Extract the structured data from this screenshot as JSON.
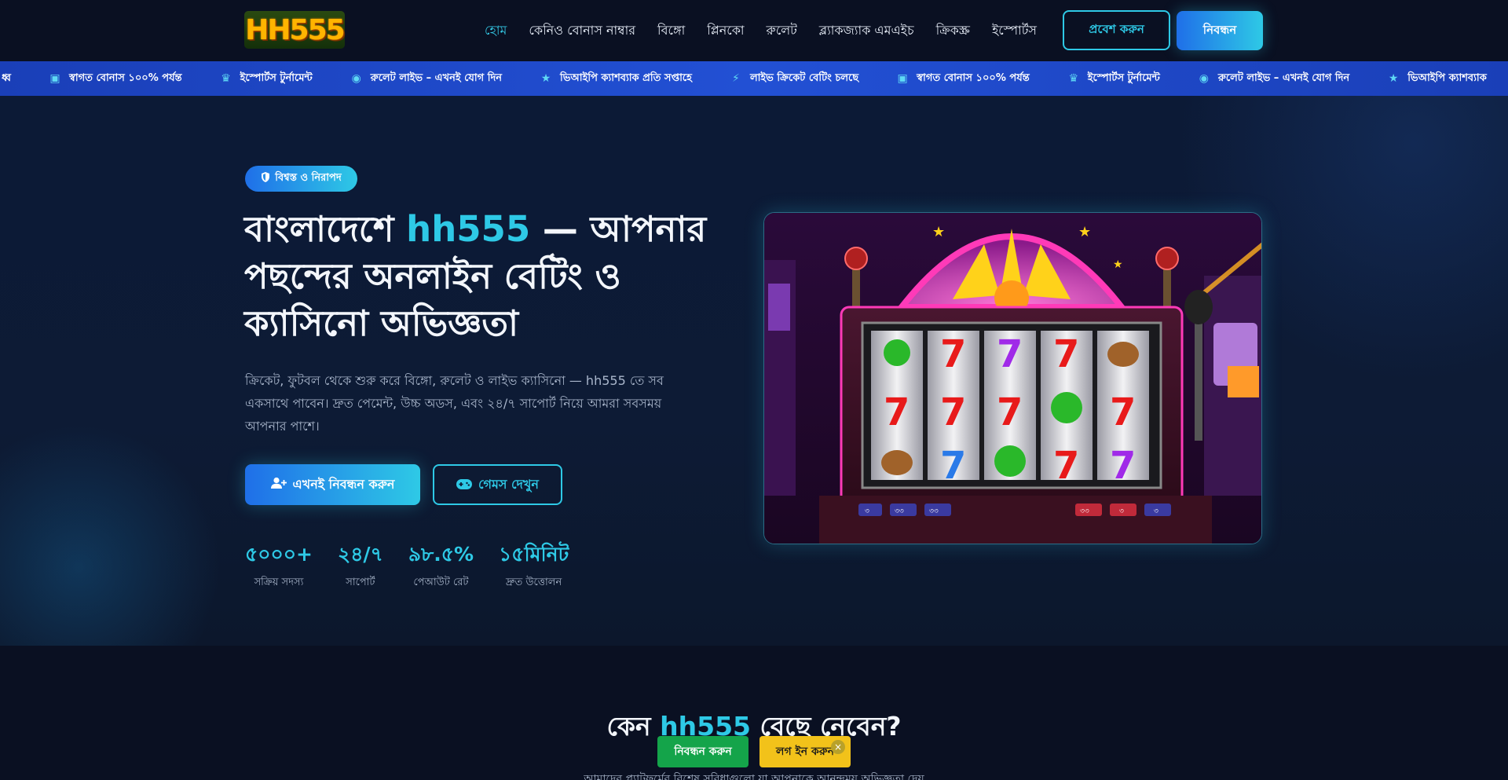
{
  "header": {
    "logo_text": "HH555",
    "nav": [
      {
        "label": "হোম",
        "active": true
      },
      {
        "label": "কেনিও বোনাস নাম্বার"
      },
      {
        "label": "বিঙ্গো"
      },
      {
        "label": "প্লিনকো"
      },
      {
        "label": "রুলেট"
      },
      {
        "label": "ব্ল্যাকজ্যাক এমএইচ"
      },
      {
        "label": "ক্রিকস্ক্র"
      },
      {
        "label": "ইস্পোর্টস"
      }
    ],
    "login_label": "প্রবেশ করুন",
    "register_label": "নিবন্ধন"
  },
  "ticker": {
    "items": [
      {
        "icon": "bolt-icon",
        "text": "ধ্ব"
      },
      {
        "icon": "gift-icon",
        "text": "স্বাগত বোনাস ১০০% পর্যন্ত"
      },
      {
        "icon": "trophy-icon",
        "text": "ইস্পোর্টস টুর্নামেন্ট"
      },
      {
        "icon": "fire-icon",
        "text": "রুলেট লাইভ – এখনই যোগ দিন"
      },
      {
        "icon": "star-icon",
        "text": "ভিআইপি ক্যাশব্যাক প্রতি সপ্তাহে"
      },
      {
        "icon": "bolt-icon",
        "text": "লাইভ ক্রিকেট বেটিং চলছে"
      },
      {
        "icon": "gift-icon",
        "text": "স্বাগত বোনাস ১০০% পর্যন্ত"
      },
      {
        "icon": "trophy-icon",
        "text": "ইস্পোর্টস টুর্নামেন্ট"
      },
      {
        "icon": "fire-icon",
        "text": "রুলেট লাইভ – এখনই যোগ দিন"
      },
      {
        "icon": "star-icon",
        "text": "ভিআইপি ক্যাশব্যাক"
      }
    ]
  },
  "hero": {
    "badge": "বিশ্বস্ত ও নিরাপদ",
    "title_pre": "বাংলাদেশে ",
    "title_brand": "hh555",
    "title_post": " — আপনার পছন্দের অনলাইন বেটিং ও ক্যাসিনো অভিজ্ঞতা",
    "description": "ক্রিকেট, ফুটবল থেকে শুরু করে বিঙ্গো, রুলেট ও লাইভ ক্যাসিনো — hh555 তে সব একসাথে পাবেন। দ্রুত পেমেন্ট, উচ্চ অডস, এবং ২৪/৭ সাপোর্ট নিয়ে আমরা সবসময় আপনার পাশে।",
    "cta_primary": "এখনই নিবন্ধন করুন",
    "cta_secondary": "গেমস দেখুন",
    "stats": [
      {
        "value": "৫০০০+",
        "label": "সক্রিয় সদস্য"
      },
      {
        "value": "২৪/৭",
        "label": "সাপোর্ট"
      },
      {
        "value": "৯৮.৫%",
        "label": "পেআউট রেট"
      },
      {
        "value": "১৫মিনিট",
        "label": "দ্রুত উত্তোলন"
      }
    ]
  },
  "slot": {
    "buttons": [
      "৩",
      "৩৩",
      "৩৩",
      "৩৩",
      "৩",
      "৩"
    ]
  },
  "why": {
    "title_pre": "কেন ",
    "title_brand": "hh555",
    "title_post": " বেছে নেবেন?",
    "subtitle": "আমাদের প্ল্যাটফর্মের বিশেষ সুবিধাগুলো যা আপনাকে আনন্দময় অভিজ্ঞতা দেয়"
  },
  "floating_bar": {
    "register_label": "নিবন্ধন করুন",
    "login_label": "লগ ইন করুন",
    "close_label": "×"
  }
}
